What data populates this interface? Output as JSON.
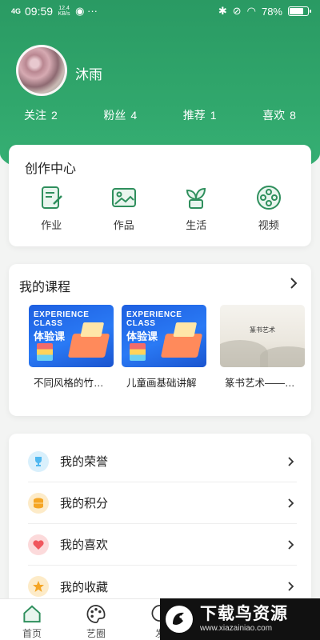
{
  "status_bar": {
    "network": "4G",
    "time": "09:59",
    "speed": "12.4 KB/s",
    "battery": "78%",
    "battery_level": 0.78
  },
  "profile": {
    "username": "沐雨",
    "stats": [
      {
        "label": "关注",
        "value": "2"
      },
      {
        "label": "粉丝",
        "value": "4"
      },
      {
        "label": "推荐",
        "value": "1"
      },
      {
        "label": "喜欢",
        "value": "8"
      }
    ]
  },
  "creation_center": {
    "title": "创作中心",
    "items": [
      {
        "label": "作业",
        "icon": "homework-icon"
      },
      {
        "label": "作品",
        "icon": "artwork-icon"
      },
      {
        "label": "生活",
        "icon": "plant-icon"
      },
      {
        "label": "视频",
        "icon": "film-reel-icon"
      }
    ]
  },
  "courses": {
    "title": "我的课程",
    "items": [
      {
        "title": "不同风格的竹…",
        "thumb_line1": "EXPERIENCE",
        "thumb_line2": "CLASS",
        "thumb_badge": "体验课"
      },
      {
        "title": "儿童画基础讲解",
        "thumb_line1": "EXPERIENCE",
        "thumb_line2": "CLASS",
        "thumb_badge": "体验课"
      },
      {
        "title": "篆书艺术——…",
        "thumb_caption1": "篆书艺术",
        "thumb_caption2": ""
      }
    ]
  },
  "menu": {
    "items": [
      {
        "label": "我的荣誉",
        "icon": "trophy-icon",
        "color": "#4fb8f0"
      },
      {
        "label": "我的积分",
        "icon": "coins-icon",
        "color": "#f5a524"
      },
      {
        "label": "我的喜欢",
        "icon": "heart-icon",
        "color": "#f0575e"
      },
      {
        "label": "我的收藏",
        "icon": "star-icon",
        "color": "#f5a524"
      }
    ]
  },
  "tabbar": {
    "tabs": [
      {
        "label": "首页",
        "icon": "home-icon"
      },
      {
        "label": "艺圈",
        "icon": "palette-icon"
      },
      {
        "label": "发",
        "icon": "publish-icon"
      }
    ]
  },
  "watermark": {
    "title": "下载鸟资源",
    "url": "www.xiazainiao.com"
  },
  "colors": {
    "accent": "#2fa66a",
    "header_green": "#31a86d"
  }
}
